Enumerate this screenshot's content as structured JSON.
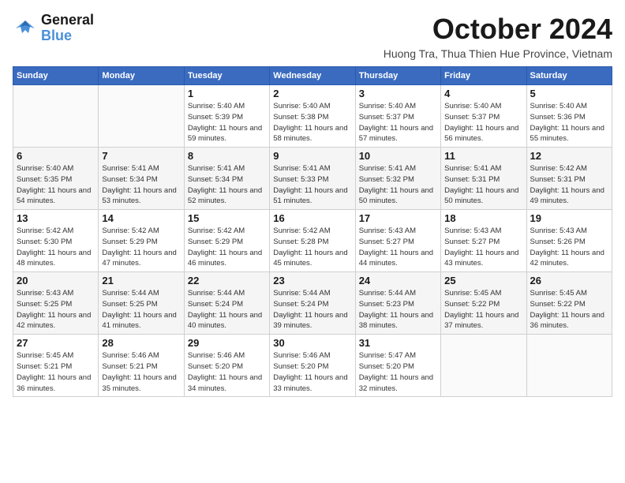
{
  "logo": {
    "line1": "General",
    "line2": "Blue"
  },
  "title": "October 2024",
  "subtitle": "Huong Tra, Thua Thien Hue Province, Vietnam",
  "header_days": [
    "Sunday",
    "Monday",
    "Tuesday",
    "Wednesday",
    "Thursday",
    "Friday",
    "Saturday"
  ],
  "weeks": [
    [
      {
        "day": "",
        "info": ""
      },
      {
        "day": "",
        "info": ""
      },
      {
        "day": "1",
        "info": "Sunrise: 5:40 AM\nSunset: 5:39 PM\nDaylight: 11 hours and 59 minutes."
      },
      {
        "day": "2",
        "info": "Sunrise: 5:40 AM\nSunset: 5:38 PM\nDaylight: 11 hours and 58 minutes."
      },
      {
        "day": "3",
        "info": "Sunrise: 5:40 AM\nSunset: 5:37 PM\nDaylight: 11 hours and 57 minutes."
      },
      {
        "day": "4",
        "info": "Sunrise: 5:40 AM\nSunset: 5:37 PM\nDaylight: 11 hours and 56 minutes."
      },
      {
        "day": "5",
        "info": "Sunrise: 5:40 AM\nSunset: 5:36 PM\nDaylight: 11 hours and 55 minutes."
      }
    ],
    [
      {
        "day": "6",
        "info": "Sunrise: 5:40 AM\nSunset: 5:35 PM\nDaylight: 11 hours and 54 minutes."
      },
      {
        "day": "7",
        "info": "Sunrise: 5:41 AM\nSunset: 5:34 PM\nDaylight: 11 hours and 53 minutes."
      },
      {
        "day": "8",
        "info": "Sunrise: 5:41 AM\nSunset: 5:34 PM\nDaylight: 11 hours and 52 minutes."
      },
      {
        "day": "9",
        "info": "Sunrise: 5:41 AM\nSunset: 5:33 PM\nDaylight: 11 hours and 51 minutes."
      },
      {
        "day": "10",
        "info": "Sunrise: 5:41 AM\nSunset: 5:32 PM\nDaylight: 11 hours and 50 minutes."
      },
      {
        "day": "11",
        "info": "Sunrise: 5:41 AM\nSunset: 5:31 PM\nDaylight: 11 hours and 50 minutes."
      },
      {
        "day": "12",
        "info": "Sunrise: 5:42 AM\nSunset: 5:31 PM\nDaylight: 11 hours and 49 minutes."
      }
    ],
    [
      {
        "day": "13",
        "info": "Sunrise: 5:42 AM\nSunset: 5:30 PM\nDaylight: 11 hours and 48 minutes."
      },
      {
        "day": "14",
        "info": "Sunrise: 5:42 AM\nSunset: 5:29 PM\nDaylight: 11 hours and 47 minutes."
      },
      {
        "day": "15",
        "info": "Sunrise: 5:42 AM\nSunset: 5:29 PM\nDaylight: 11 hours and 46 minutes."
      },
      {
        "day": "16",
        "info": "Sunrise: 5:42 AM\nSunset: 5:28 PM\nDaylight: 11 hours and 45 minutes."
      },
      {
        "day": "17",
        "info": "Sunrise: 5:43 AM\nSunset: 5:27 PM\nDaylight: 11 hours and 44 minutes."
      },
      {
        "day": "18",
        "info": "Sunrise: 5:43 AM\nSunset: 5:27 PM\nDaylight: 11 hours and 43 minutes."
      },
      {
        "day": "19",
        "info": "Sunrise: 5:43 AM\nSunset: 5:26 PM\nDaylight: 11 hours and 42 minutes."
      }
    ],
    [
      {
        "day": "20",
        "info": "Sunrise: 5:43 AM\nSunset: 5:25 PM\nDaylight: 11 hours and 42 minutes."
      },
      {
        "day": "21",
        "info": "Sunrise: 5:44 AM\nSunset: 5:25 PM\nDaylight: 11 hours and 41 minutes."
      },
      {
        "day": "22",
        "info": "Sunrise: 5:44 AM\nSunset: 5:24 PM\nDaylight: 11 hours and 40 minutes."
      },
      {
        "day": "23",
        "info": "Sunrise: 5:44 AM\nSunset: 5:24 PM\nDaylight: 11 hours and 39 minutes."
      },
      {
        "day": "24",
        "info": "Sunrise: 5:44 AM\nSunset: 5:23 PM\nDaylight: 11 hours and 38 minutes."
      },
      {
        "day": "25",
        "info": "Sunrise: 5:45 AM\nSunset: 5:22 PM\nDaylight: 11 hours and 37 minutes."
      },
      {
        "day": "26",
        "info": "Sunrise: 5:45 AM\nSunset: 5:22 PM\nDaylight: 11 hours and 36 minutes."
      }
    ],
    [
      {
        "day": "27",
        "info": "Sunrise: 5:45 AM\nSunset: 5:21 PM\nDaylight: 11 hours and 36 minutes."
      },
      {
        "day": "28",
        "info": "Sunrise: 5:46 AM\nSunset: 5:21 PM\nDaylight: 11 hours and 35 minutes."
      },
      {
        "day": "29",
        "info": "Sunrise: 5:46 AM\nSunset: 5:20 PM\nDaylight: 11 hours and 34 minutes."
      },
      {
        "day": "30",
        "info": "Sunrise: 5:46 AM\nSunset: 5:20 PM\nDaylight: 11 hours and 33 minutes."
      },
      {
        "day": "31",
        "info": "Sunrise: 5:47 AM\nSunset: 5:20 PM\nDaylight: 11 hours and 32 minutes."
      },
      {
        "day": "",
        "info": ""
      },
      {
        "day": "",
        "info": ""
      }
    ]
  ]
}
